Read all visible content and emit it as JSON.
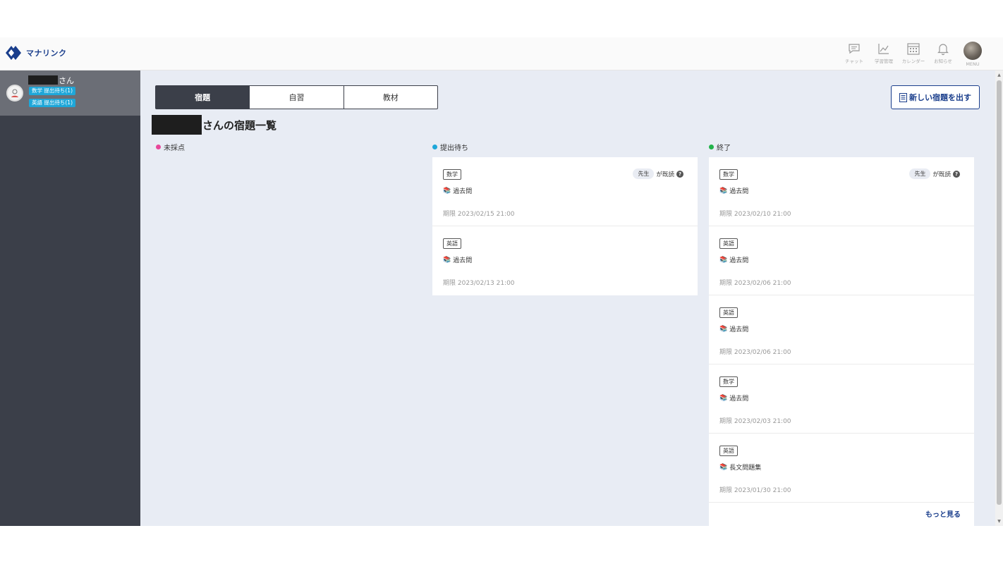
{
  "app": {
    "brand": "マナリンク"
  },
  "nav": [
    {
      "label": "チャット",
      "icon": "chat-icon"
    },
    {
      "label": "学習管理",
      "icon": "chart-icon"
    },
    {
      "label": "カレンダー",
      "icon": "calendar-icon"
    },
    {
      "label": "お知らせ",
      "icon": "bell-icon"
    },
    {
      "label": "MENU",
      "icon": "avatar"
    }
  ],
  "sidebar": {
    "student": {
      "suffix": "さん",
      "badges": [
        "数学 提出待ち(1)",
        "英語 提出待ち(1)"
      ]
    }
  },
  "tabs": [
    {
      "label": "宿題",
      "active": true
    },
    {
      "label": "自習",
      "active": false
    },
    {
      "label": "教材",
      "active": false
    }
  ],
  "new_homework_button": "新しい宿題を出す",
  "page_title_suffix": "さんの宿題一覧",
  "columns": [
    {
      "title": "未採点",
      "color": "#e8479a",
      "cards": []
    },
    {
      "title": "提出待ち",
      "color": "#1ea7d9",
      "cards": [
        {
          "subject": "数学",
          "teacher": "先生",
          "read_suffix": "が既読",
          "material": "過去問",
          "deadline": "期限 2023/02/15 21:00"
        },
        {
          "subject": "英語",
          "material": "過去問",
          "deadline": "期限 2023/02/13 21:00"
        }
      ]
    },
    {
      "title": "終了",
      "color": "#22b34a",
      "cards": [
        {
          "subject": "数学",
          "teacher": "先生",
          "read_suffix": "が既読",
          "material": "過去問",
          "deadline": "期限 2023/02/10 21:00"
        },
        {
          "subject": "英語",
          "material": "過去問",
          "deadline": "期限 2023/02/06 21:00"
        },
        {
          "subject": "英語",
          "material": "過去問",
          "deadline": "期限 2023/02/06 21:00"
        },
        {
          "subject": "数学",
          "material": "過去問",
          "deadline": "期限 2023/02/03 21:00"
        },
        {
          "subject": "英語",
          "material": "長文問題集",
          "deadline": "期限 2023/01/30 21:00"
        }
      ],
      "more_label": "もっと見る"
    }
  ],
  "colors": {
    "brand": "#1a3e8c",
    "sidebar": "#3b3f49",
    "accent": "#1ea7d9",
    "background": "#e8ecf4"
  }
}
